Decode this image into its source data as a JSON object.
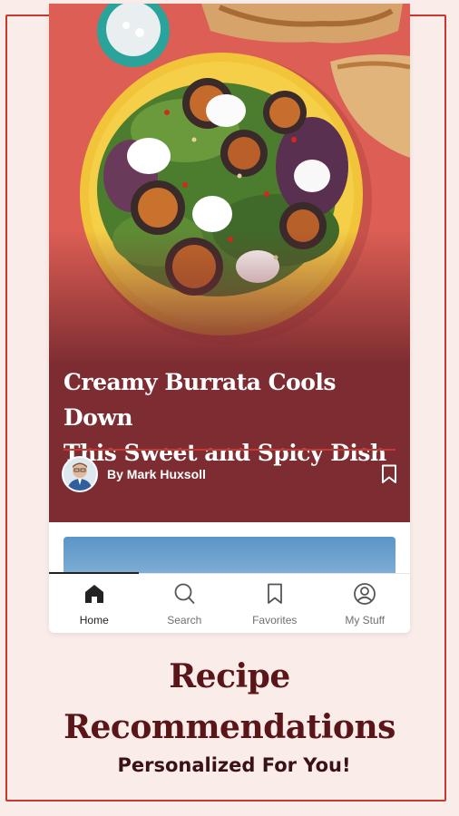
{
  "article": {
    "headline_line1": "Creamy Burrata Cools Down",
    "headline_line2": "This Sweet and Spicy Dish",
    "byline": "By Mark Huxsoll"
  },
  "tabbar": {
    "tabs": [
      {
        "label": "Home",
        "icon": "home-icon",
        "active": true
      },
      {
        "label": "Search",
        "icon": "search-icon",
        "active": false
      },
      {
        "label": "Favorites",
        "icon": "bookmark-icon",
        "active": false
      },
      {
        "label": "My Stuff",
        "icon": "user-icon",
        "active": false
      }
    ]
  },
  "promo": {
    "title_line1": "Recipe",
    "title_line2": "Recommendations",
    "subtitle": "Personalized For You!"
  },
  "colors": {
    "background": "#f9ece9",
    "accent_red": "#c7382e",
    "hero_maroon": "#7d2c31",
    "promo_text": "#5a1518"
  }
}
